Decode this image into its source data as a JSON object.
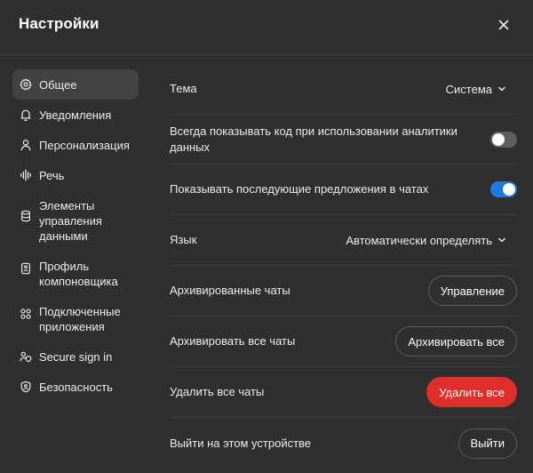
{
  "dialog": {
    "title": "Настройки",
    "close_icon": "close-icon"
  },
  "sidebar": {
    "items": [
      {
        "label": "Общее",
        "icon": "gear-icon",
        "active": true
      },
      {
        "label": "Уведомления",
        "icon": "bell-icon",
        "active": false
      },
      {
        "label": "Персонализация",
        "icon": "person-icon",
        "active": false
      },
      {
        "label": "Речь",
        "icon": "waveform-icon",
        "active": false
      },
      {
        "label": "Элементы управления данными",
        "icon": "database-icon",
        "active": false
      },
      {
        "label": "Профиль компоновщика",
        "icon": "id-card-icon",
        "active": false
      },
      {
        "label": "Подключенные приложения",
        "icon": "apps-icon",
        "active": false
      },
      {
        "label": "Secure sign in",
        "icon": "secure-signin-icon",
        "active": false
      },
      {
        "label": "Безопасность",
        "icon": "shield-icon",
        "active": false
      }
    ]
  },
  "settings": {
    "theme": {
      "label": "Тема",
      "value": "Система"
    },
    "show_code": {
      "label": "Всегда показывать код при использовании аналитики данных",
      "enabled": false
    },
    "follow_up": {
      "label": "Показывать последующие предложения в чатах",
      "enabled": true
    },
    "language": {
      "label": "Язык",
      "value": "Автоматически определять"
    },
    "archived": {
      "label": "Архивированные чаты",
      "button": "Управление"
    },
    "archive_all": {
      "label": "Архивировать все чаты",
      "button": "Архивировать все"
    },
    "delete_all": {
      "label": "Удалить все чаты",
      "button": "Удалить все"
    },
    "logout": {
      "label": "Выйти на этом устройстве",
      "button": "Выйти"
    }
  },
  "colors": {
    "background": "#2f2f2f",
    "active_nav": "#424242",
    "toggle_on": "#1f7ae0",
    "danger": "#e02e2a"
  }
}
